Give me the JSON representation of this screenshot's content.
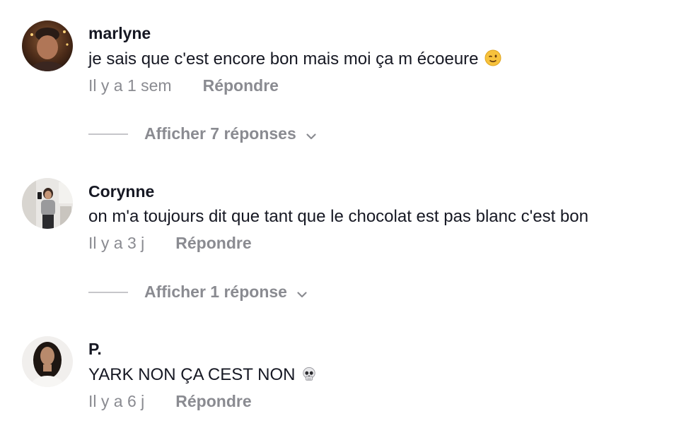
{
  "comments": [
    {
      "username": "marlyne",
      "text": "je sais que c'est encore bon mais moi ça m écoeure",
      "emoji": "winking-face-emoji",
      "time": "Il y a 1 sem",
      "reply_label": "Répondre",
      "view_replies": "Afficher 7 réponses"
    },
    {
      "username": "Corynne",
      "text": "on m'a toujours dit que tant que le chocolat est pas blanc c'est bon",
      "time": "Il y a 3 j",
      "reply_label": "Répondre",
      "view_replies": "Afficher 1 réponse"
    },
    {
      "username": "P.",
      "text": "YARK NON ÇA CEST NON",
      "emoji": "skull-emoji",
      "time": "Il y a 6 j",
      "reply_label": "Répondre"
    }
  ],
  "colors": {
    "primary_text": "#161823",
    "secondary_text": "#8a8b91",
    "divider": "#c6c6ca"
  }
}
